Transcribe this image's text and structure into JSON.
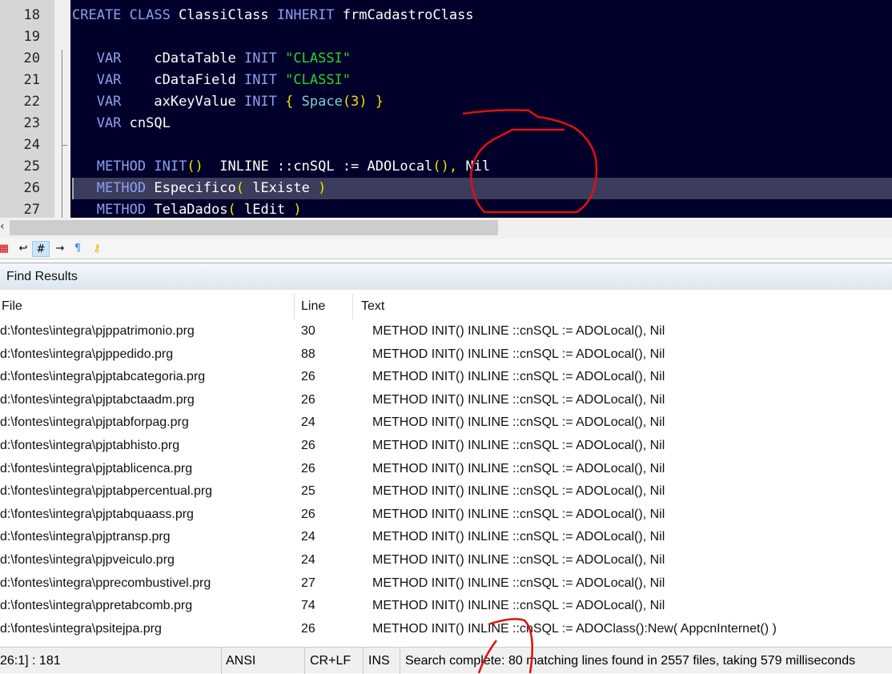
{
  "editor": {
    "lines": [
      {
        "n": "18",
        "t": [
          [
            "kw",
            "CREATE CLASS "
          ],
          [
            "",
            "ClassiClass "
          ],
          [
            "kw",
            "INHERIT "
          ],
          [
            "",
            "frmCadastroClass"
          ]
        ]
      },
      {
        "n": "19",
        "t": []
      },
      {
        "n": "20",
        "t": [
          [
            "kw",
            "   VAR    "
          ],
          [
            "",
            "cDataTable "
          ],
          [
            "kw",
            "INIT "
          ],
          [
            "st",
            "\"CLASSI\""
          ]
        ]
      },
      {
        "n": "21",
        "t": [
          [
            "kw",
            "   VAR    "
          ],
          [
            "",
            "cDataField "
          ],
          [
            "kw",
            "INIT "
          ],
          [
            "st",
            "\"CLASSI\""
          ]
        ]
      },
      {
        "n": "22",
        "t": [
          [
            "kw",
            "   VAR    "
          ],
          [
            "",
            "axKeyValue "
          ],
          [
            "kw",
            "INIT "
          ],
          [
            "br",
            "{ "
          ],
          [
            "fn",
            "Space"
          ],
          [
            "br",
            "(3) }"
          ]
        ]
      },
      {
        "n": "23",
        "t": [
          [
            "kw",
            "   VAR "
          ],
          [
            "",
            "cnSQL"
          ]
        ]
      },
      {
        "n": "24",
        "t": []
      },
      {
        "n": "25",
        "t": [
          [
            "kw",
            "   METHOD "
          ],
          [
            "kw",
            "INIT"
          ],
          [
            "br",
            "()"
          ],
          [
            "",
            "  INLINE ::cnSQL := ADOLocal"
          ],
          [
            "br",
            "()"
          ],
          [
            "br",
            ","
          ],
          [
            "",
            " Nil"
          ]
        ]
      },
      {
        "n": "26",
        "t": [
          [
            "kw",
            "   METHOD "
          ],
          [
            "",
            "Especifico"
          ],
          [
            "br",
            "("
          ],
          [
            "",
            " lExiste "
          ],
          [
            "br",
            ")"
          ]
        ]
      },
      {
        "n": "27",
        "t": [
          [
            "kw",
            "   METHOD "
          ],
          [
            "",
            "TelaDados"
          ],
          [
            "br",
            "("
          ],
          [
            "",
            " lEdit "
          ],
          [
            "br",
            ")"
          ]
        ]
      }
    ]
  },
  "find_results": {
    "title": "Find Results",
    "columns": [
      "File",
      "Line",
      "Text"
    ],
    "rows": [
      [
        "d:\\fontes\\integra\\pjppatrimonio.prg",
        "30",
        "METHOD INIT() INLINE ::cnSQL := ADOLocal(), Nil"
      ],
      [
        "d:\\fontes\\integra\\pjppedido.prg",
        "88",
        "METHOD INIT() INLINE ::cnSQL := ADOLocal(), Nil"
      ],
      [
        "d:\\fontes\\integra\\pjptabcategoria.prg",
        "26",
        "METHOD INIT() INLINE ::cnSQL := ADOLocal(), Nil"
      ],
      [
        "d:\\fontes\\integra\\pjptabctaadm.prg",
        "26",
        "METHOD INIT() INLINE ::cnSQL := ADOLocal(), Nil"
      ],
      [
        "d:\\fontes\\integra\\pjptabforpag.prg",
        "24",
        "METHOD INIT() INLINE ::cnSQL := ADOLocal(), Nil"
      ],
      [
        "d:\\fontes\\integra\\pjptabhisto.prg",
        "26",
        "METHOD INIT() INLINE ::cnSQL := ADOLocal(), Nil"
      ],
      [
        "d:\\fontes\\integra\\pjptablicenca.prg",
        "26",
        "METHOD INIT() INLINE ::cnSQL := ADOLocal(), Nil"
      ],
      [
        "d:\\fontes\\integra\\pjptabpercentual.prg",
        "25",
        "METHOD INIT() INLINE ::cnSQL := ADOLocal(), Nil"
      ],
      [
        "d:\\fontes\\integra\\pjptabquaass.prg",
        "26",
        "METHOD INIT() INLINE ::cnSQL := ADOLocal(), Nil"
      ],
      [
        "d:\\fontes\\integra\\pjptransp.prg",
        "24",
        "METHOD INIT() INLINE ::cnSQL := ADOLocal(), Nil"
      ],
      [
        "d:\\fontes\\integra\\pjpveiculo.prg",
        "24",
        "METHOD INIT() INLINE ::cnSQL := ADOLocal(), Nil"
      ],
      [
        "d:\\fontes\\integra\\pprecombustivel.prg",
        "27",
        "METHOD INIT() INLINE ::cnSQL := ADOLocal(), Nil"
      ],
      [
        "d:\\fontes\\integra\\ppretabcomb.prg",
        "74",
        "METHOD INIT() INLINE ::cnSQL := ADOLocal(), Nil"
      ],
      [
        "d:\\fontes\\integra\\psitejpa.prg",
        "26",
        "METHOD INIT()     INLINE ::cnSQL := ADOClass():New( AppcnInternet() )"
      ]
    ]
  },
  "status": {
    "position": "26:1] : 181",
    "encoding": "ANSI",
    "line_ending": "CR+LF",
    "mode": "INS",
    "message": "Search complete: 80 matching lines found in 2557 files, taking 579 milliseconds"
  },
  "toolbar": {
    "scroll_left": "‹",
    "icons": [
      "color-icon",
      "wrap-icon",
      "hash-icon",
      "tab-arrow-icon",
      "pilcrow-icon",
      "key-icon"
    ]
  }
}
